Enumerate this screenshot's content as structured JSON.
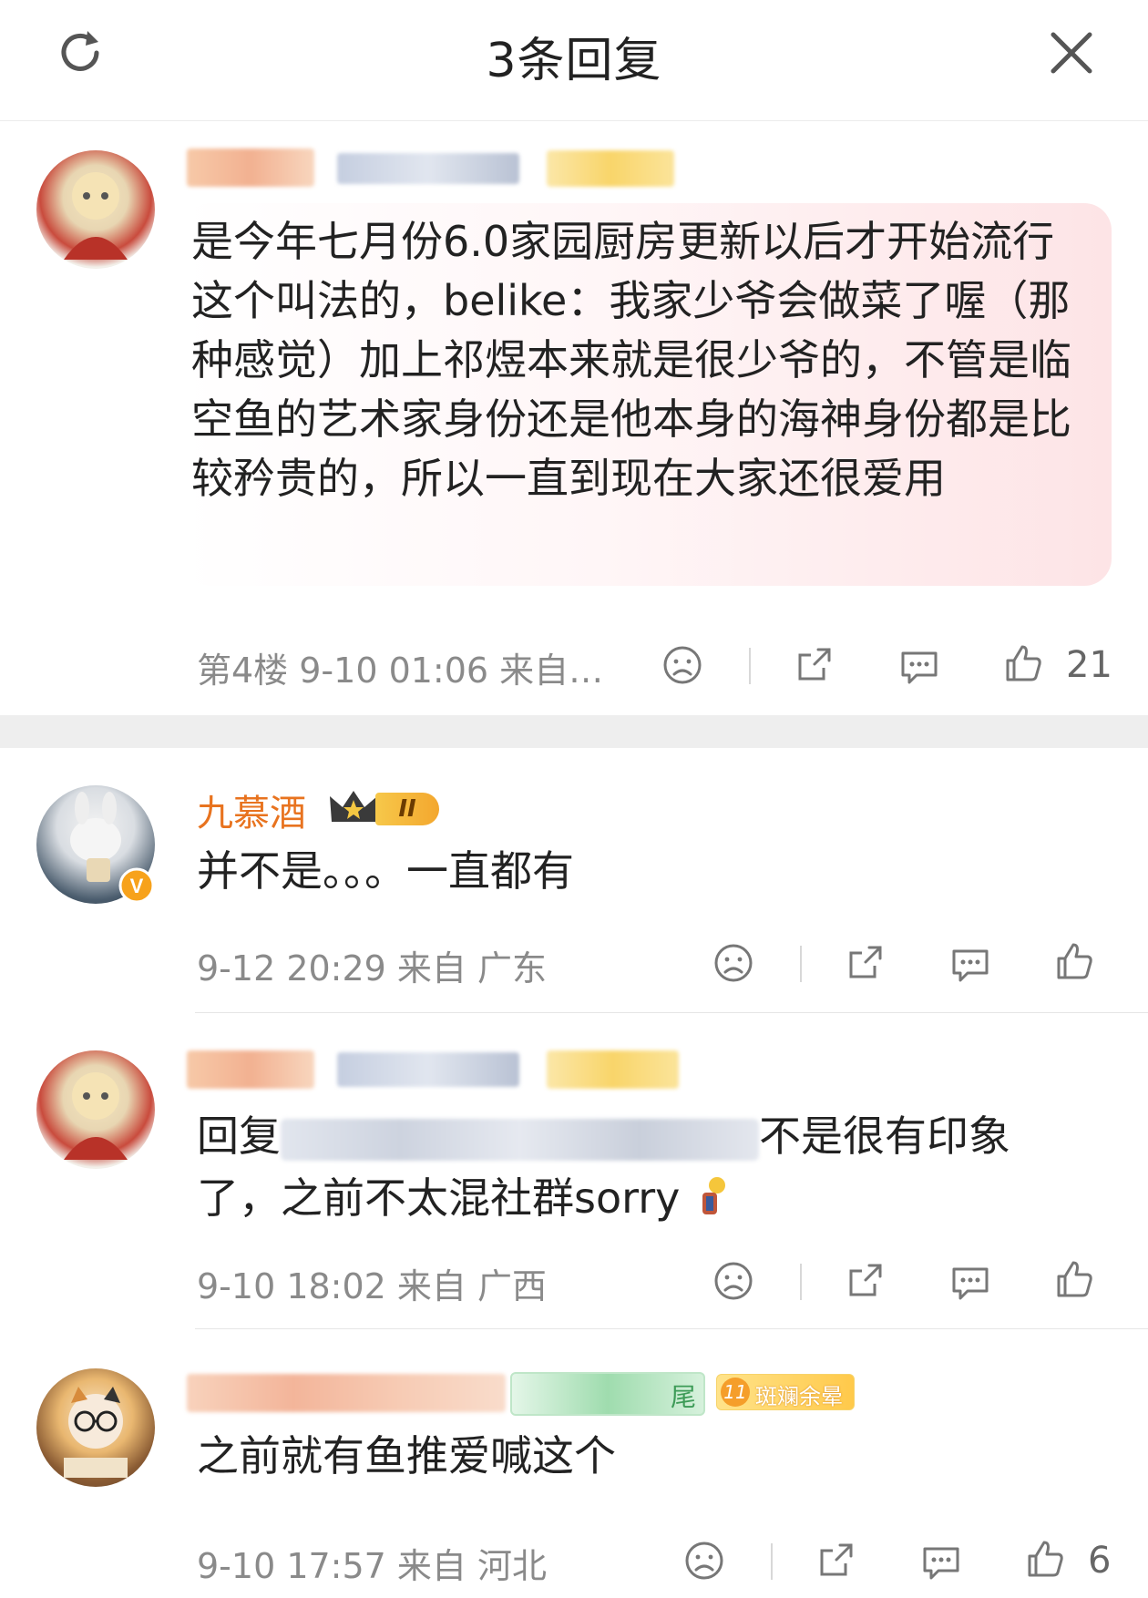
{
  "header": {
    "title": "3条回复"
  },
  "icons": {
    "refresh": "refresh-icon",
    "close": "close-icon",
    "dislike": "sad-face-icon",
    "share": "share-icon",
    "comment": "comment-icon",
    "like": "thumbs-up-icon"
  },
  "main_comment": {
    "text": "是今年七月份6.0家园厨房更新以后才开始流行这个叫法的，belike：我家少爷会做菜了喔（那种感觉）加上祁煜本来就是很少爷的，不管是临空鱼的艺术家身份还是他本身的海神身份都是比较矜贵的，所以一直到现在大家还很爱用",
    "meta": "第4楼  9-10 01:06  来自…",
    "likes": "21"
  },
  "replies": [
    {
      "username": "九慕酒",
      "badge": "II",
      "text": "并不是。。。一直都有",
      "meta": "9-12 20:29  来自 广东",
      "likes": ""
    },
    {
      "username": "",
      "prefix": "回复",
      "text": "不是很有印象了，之前不太混社群sorry",
      "meta": "9-10 18:02  来自 广西",
      "likes": ""
    },
    {
      "username": "",
      "fan_badge_suffix": "尾",
      "badge": "斑斓余晕",
      "badge_level": "11",
      "text": "之前就有鱼推爱喊这个",
      "meta": "9-10 17:57  来自 河北",
      "likes": "6"
    }
  ],
  "colors": {
    "username": "#e8731f",
    "meta": "#8a8a8a",
    "gap": "#eeeeee",
    "bubble": "#fde4e6"
  }
}
